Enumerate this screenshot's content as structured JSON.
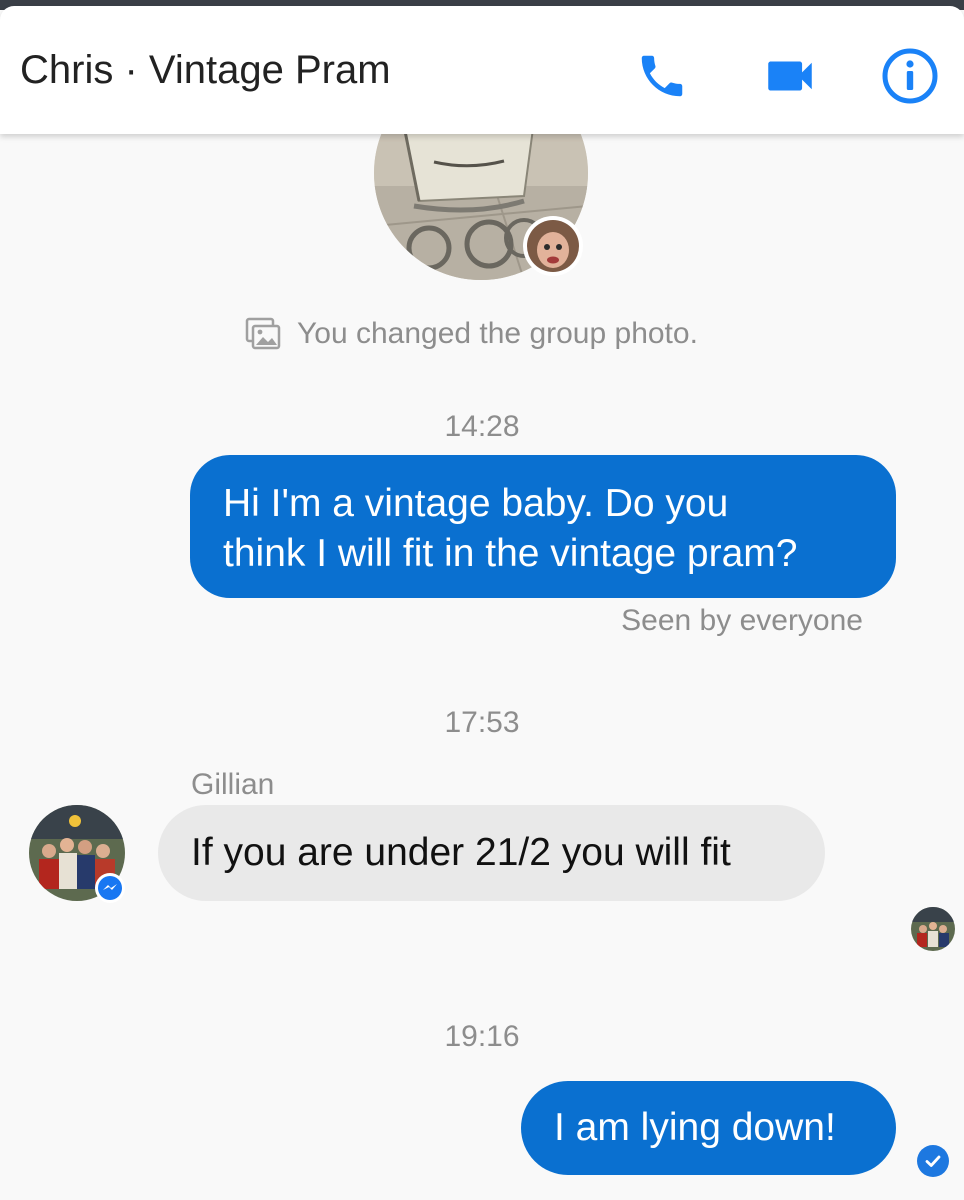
{
  "header": {
    "title": "Chris · Vintage Pram",
    "icons": [
      "phone-icon",
      "video-camera-icon",
      "info-icon"
    ]
  },
  "colors": {
    "accent": "#1a82f7",
    "outgoing_bubble": "#0a70d0",
    "incoming_bubble": "#e9e9e9",
    "secondary_text": "#8d8d8d",
    "background": "#f9f9f9"
  },
  "system_message": {
    "text": "You changed the group photo.",
    "icon": "image-icon"
  },
  "timestamps": [
    "14:28",
    "17:53",
    "19:16"
  ],
  "messages": [
    {
      "direction": "outgoing",
      "text": "Hi I'm a vintage baby. Do you think I will fit in the vintage pram?",
      "lines": [
        "Hi I'm a vintage baby. Do you",
        "think I will fit in the vintage pram?"
      ],
      "status": "Seen by everyone"
    },
    {
      "direction": "incoming",
      "sender": "Gillian",
      "text": "If you are under 21/2 you will fit"
    },
    {
      "direction": "outgoing",
      "text": "I am lying down!",
      "status_icon": "check-circle-icon"
    }
  ]
}
